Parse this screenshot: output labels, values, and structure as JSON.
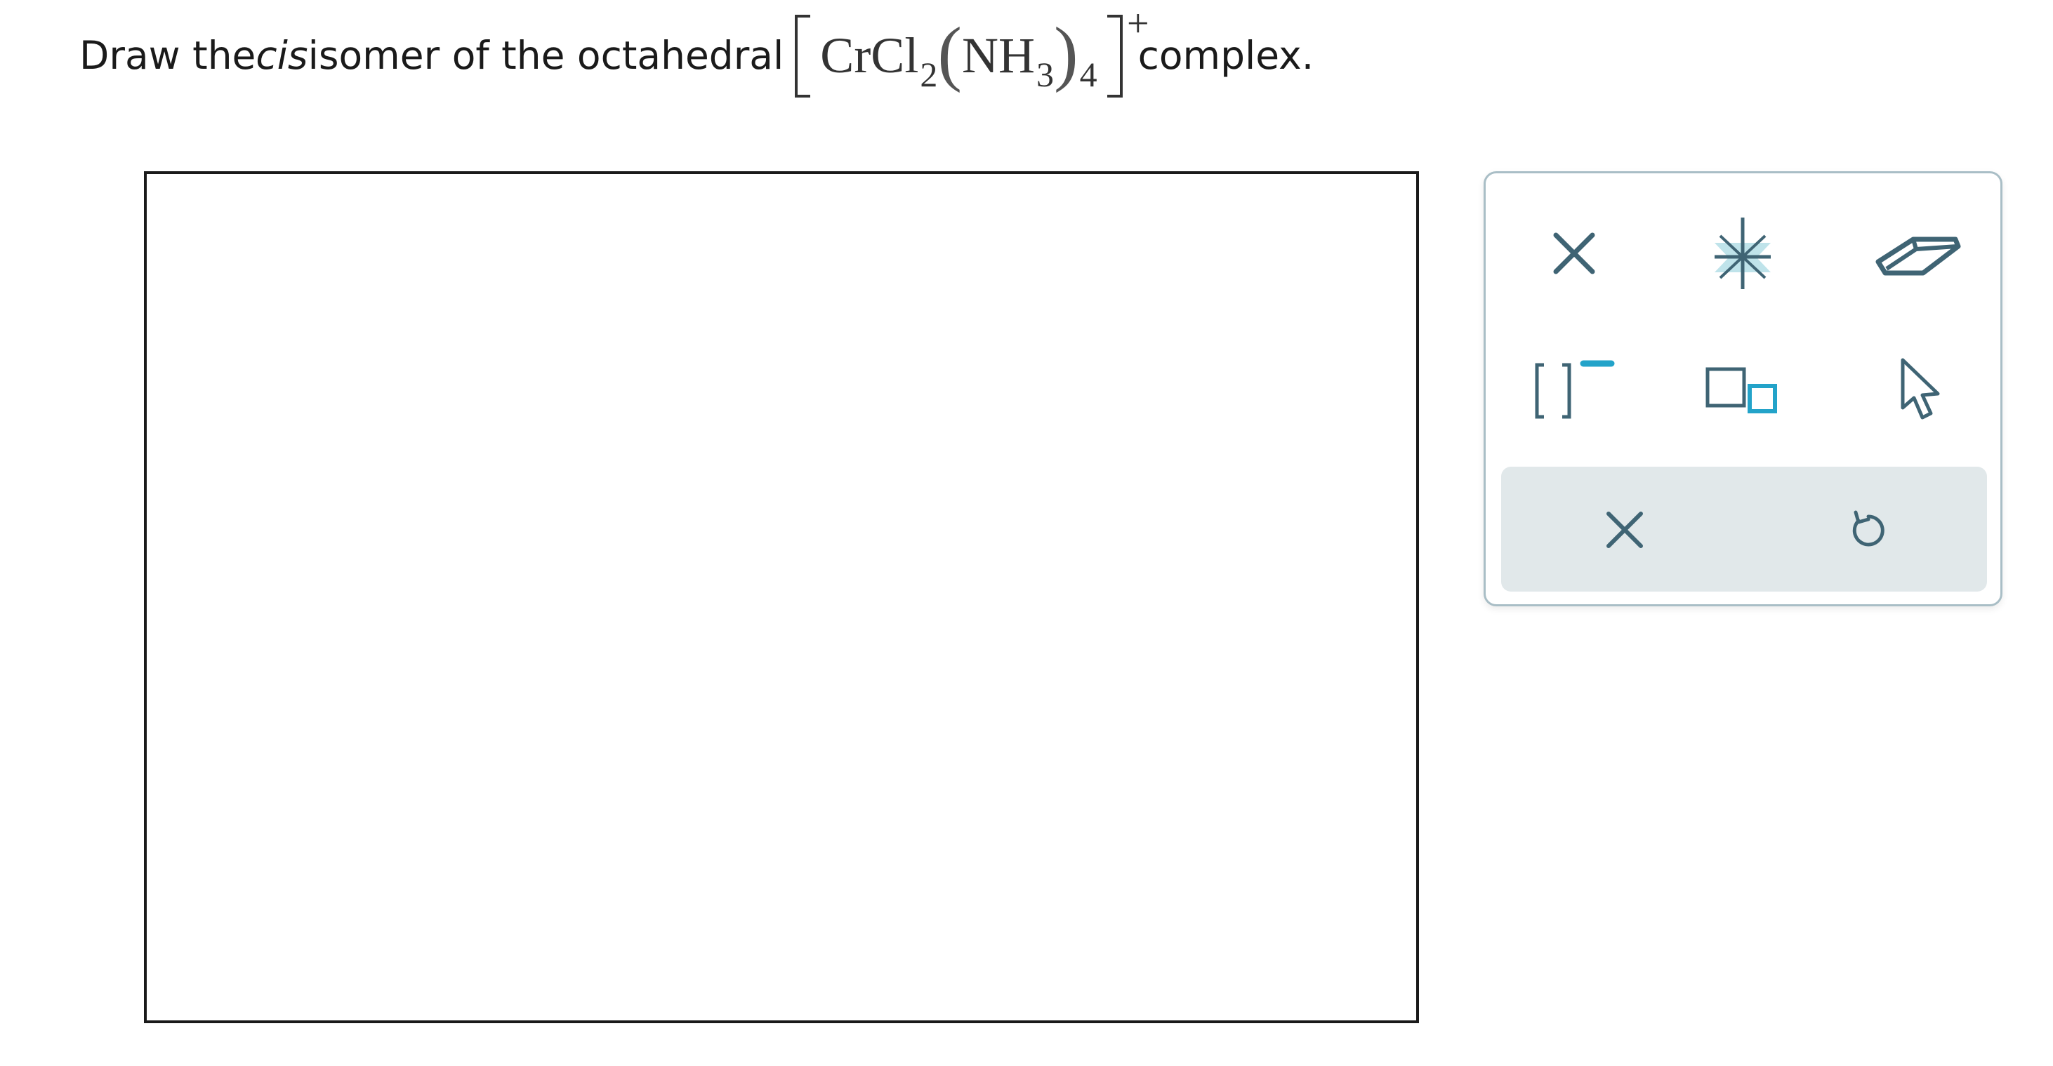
{
  "question": {
    "prefix": "Draw the ",
    "emphasis": "cis",
    "middle": " isomer of the octahedral ",
    "suffix": " complex."
  },
  "formula": {
    "metal_ligand": "CrCl",
    "sub_cl": "2",
    "paren_open": "(",
    "ligand": "NH",
    "sub_nh": "3",
    "paren_close": ")",
    "sub_count": "4",
    "charge": "+"
  },
  "toolbox": {
    "tools": [
      {
        "name": "bond-tool",
        "icon": "x-bond-icon"
      },
      {
        "name": "lone-pair-tool",
        "icon": "asterisk-bond-icon"
      },
      {
        "name": "eraser-tool",
        "icon": "eraser-icon"
      },
      {
        "name": "bracket-charge-tool",
        "icon": "bracket-charge-icon"
      },
      {
        "name": "templates-tool",
        "icon": "squares-icon"
      },
      {
        "name": "select-tool",
        "icon": "cursor-icon"
      }
    ],
    "actions": [
      {
        "name": "clear",
        "icon": "close-icon"
      },
      {
        "name": "undo",
        "icon": "undo-icon"
      }
    ],
    "colors": {
      "icon": "#3f6474",
      "accent": "#23a3c9",
      "action_bar_bg": "#e1e8ea",
      "border": "#a9bec6"
    }
  }
}
